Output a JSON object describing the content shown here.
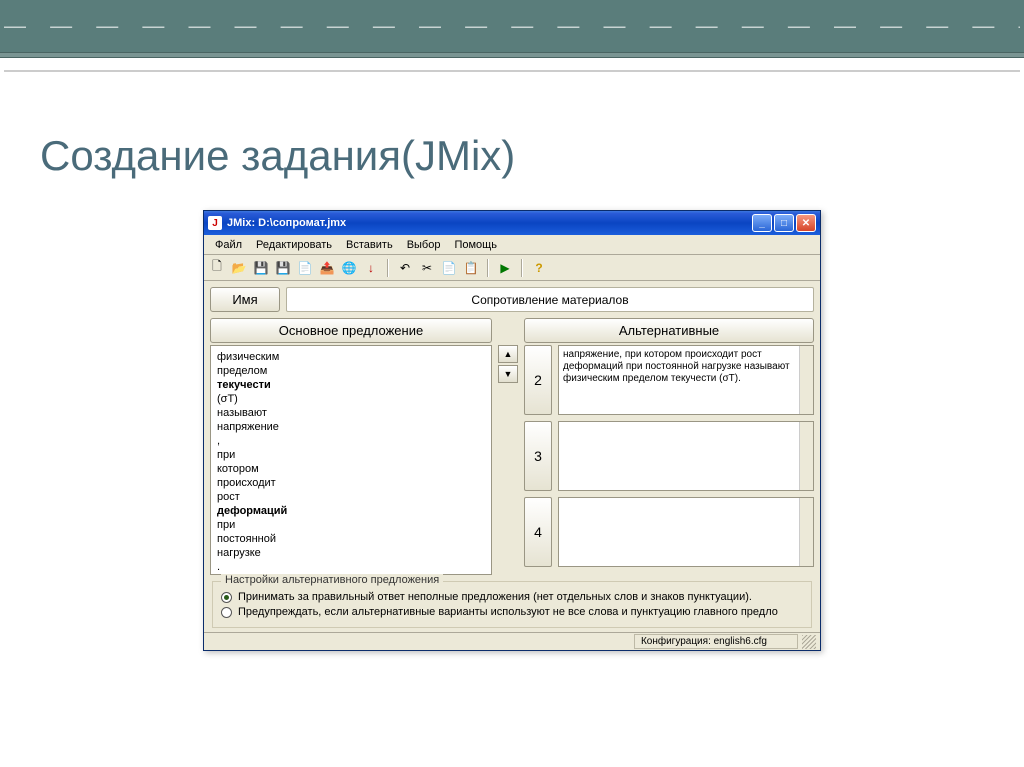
{
  "slide": {
    "title": "Создание задания(JMix)"
  },
  "window": {
    "title": "JMix: D:\\сопромат.jmx",
    "menu": [
      "Файл",
      "Редактировать",
      "Вставить",
      "Выбор",
      "Помощь"
    ],
    "toolbar_icons": [
      "new-icon",
      "open-icon",
      "save-icon",
      "saveall-icon",
      "addfile-icon",
      "export-icon",
      "web-icon",
      "down-icon",
      "undo-icon",
      "cut-icon",
      "copy-icon",
      "paste-icon",
      "run-icon",
      "help-icon"
    ],
    "toolbar_glyphs": [
      "🗋",
      "📂",
      "💾",
      "💾",
      "📄",
      "📤",
      "🌐",
      "↓",
      "↶",
      "✂",
      "📄",
      "📋",
      "▶",
      "?"
    ],
    "name_label": "Имя",
    "name_value": "Сопротивление материалов",
    "main_label": "Основное предложение",
    "alt_label": "Альтернативные",
    "words": [
      "физическим",
      "пределом",
      "текучести",
      "(σТ)",
      "называют",
      "напряжение",
      ",",
      "при",
      "котором",
      "происходит",
      "рост",
      "деформаций",
      "при",
      "постоянной",
      "нагрузке",
      "."
    ],
    "alts": [
      {
        "n": "2",
        "text": "напряжение, при котором происходит рост деформаций при постоянной нагрузке называют физическим пределом текучести (σТ)."
      },
      {
        "n": "3",
        "text": ""
      },
      {
        "n": "4",
        "text": ""
      }
    ],
    "group_legend": "Настройки альтернативного предложения",
    "opt1": "Принимать за правильный ответ неполные предложения (нет отдельных слов и знаков пунктуации).",
    "opt2": "Предупреждать, если альтернативные варианты используют не все слова и пунктуацию главного предло",
    "status": "Конфигурация: english6.cfg"
  }
}
